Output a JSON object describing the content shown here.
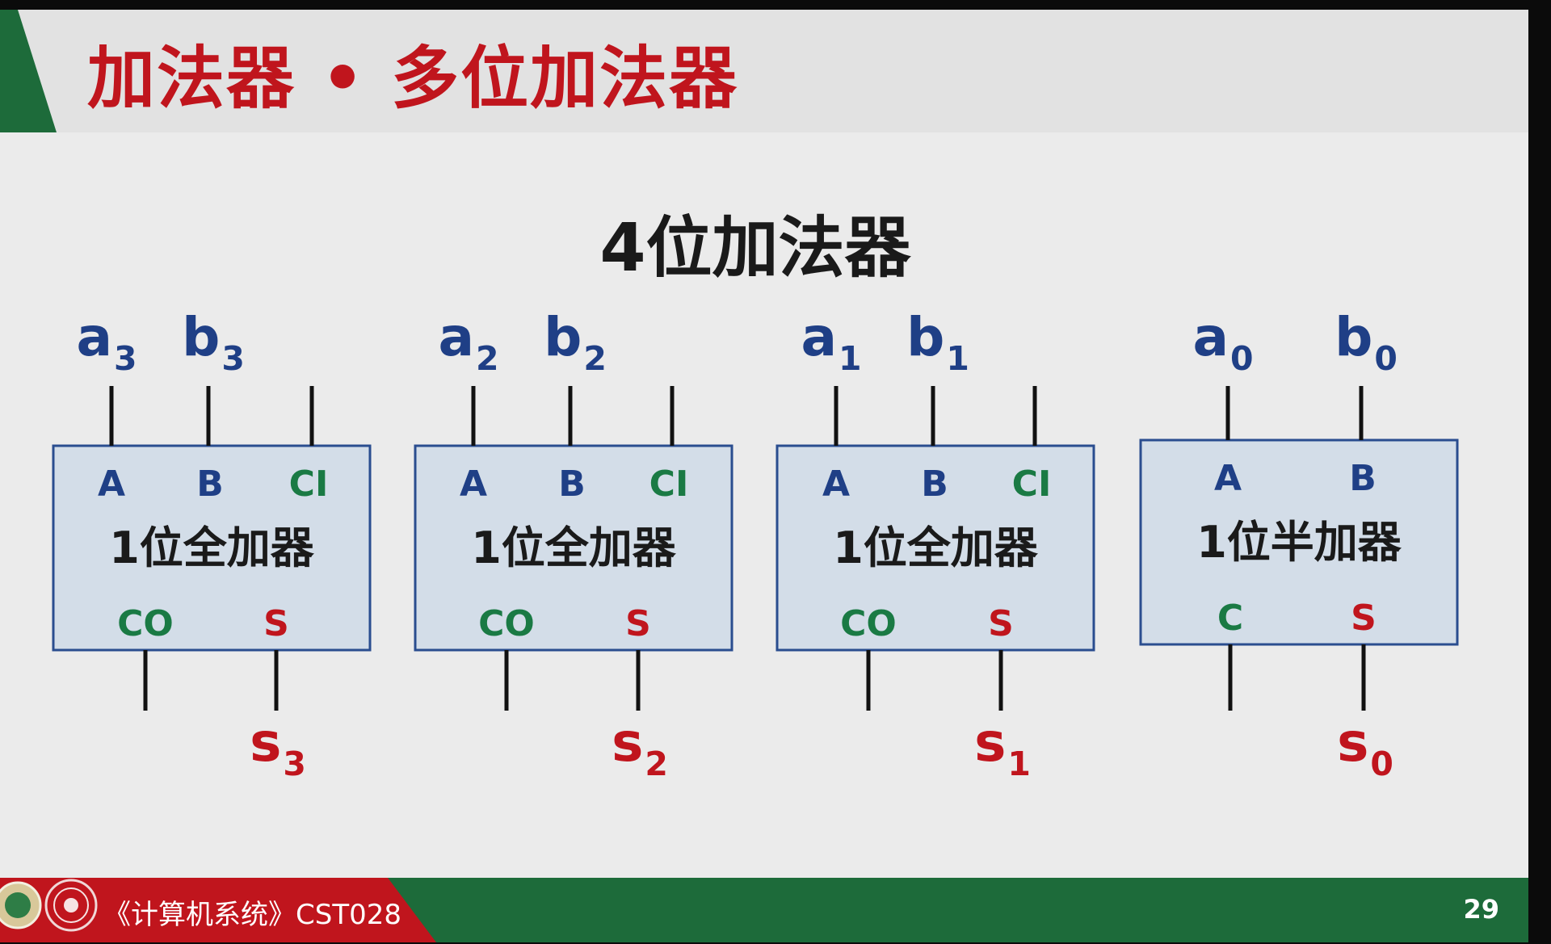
{
  "slide": {
    "title": "加法器 • 多位加法器",
    "diagram_title": "4位加法器",
    "course": "《计算机系统》CST028",
    "page_number": "29"
  },
  "colors": {
    "accent_red": "#c0151d",
    "accent_green": "#1d6b3a",
    "input_blue": "#1f3f86",
    "carry_green": "#1a7a44",
    "block_fill": "#d3dde8",
    "block_stroke": "#2a4d8f"
  },
  "adders": [
    {
      "label": "1位全加器",
      "input_a": {
        "name": "a",
        "sub": "3"
      },
      "input_b": {
        "name": "b",
        "sub": "3"
      },
      "output_s": {
        "name": "s",
        "sub": "3"
      },
      "ports": {
        "a": "A",
        "b": "B",
        "ci": "CI",
        "co": "CO",
        "s": "S"
      }
    },
    {
      "label": "1位全加器",
      "input_a": {
        "name": "a",
        "sub": "2"
      },
      "input_b": {
        "name": "b",
        "sub": "2"
      },
      "output_s": {
        "name": "s",
        "sub": "2"
      },
      "ports": {
        "a": "A",
        "b": "B",
        "ci": "CI",
        "co": "CO",
        "s": "S"
      }
    },
    {
      "label": "1位全加器",
      "input_a": {
        "name": "a",
        "sub": "1"
      },
      "input_b": {
        "name": "b",
        "sub": "1"
      },
      "output_s": {
        "name": "s",
        "sub": "1"
      },
      "ports": {
        "a": "A",
        "b": "B",
        "ci": "CI",
        "co": "CO",
        "s": "S"
      }
    },
    {
      "label": "1位半加器",
      "input_a": {
        "name": "a",
        "sub": "0"
      },
      "input_b": {
        "name": "b",
        "sub": "0"
      },
      "output_s": {
        "name": "s",
        "sub": "0"
      },
      "ports": {
        "a": "A",
        "b": "B",
        "co": "C",
        "s": "S"
      }
    }
  ]
}
